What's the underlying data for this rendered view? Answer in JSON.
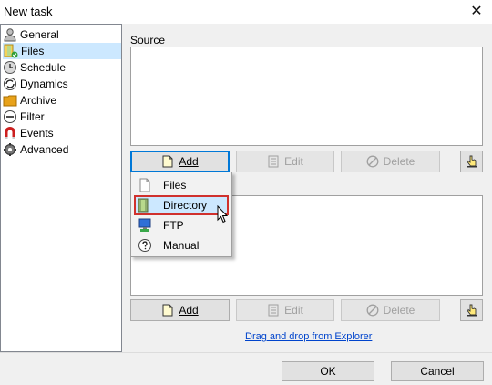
{
  "window": {
    "title": "New task",
    "close_glyph": "✕"
  },
  "nav": {
    "items": [
      {
        "label": "General",
        "icon": "person-icon"
      },
      {
        "label": "Files",
        "icon": "files-check-icon",
        "selected": true
      },
      {
        "label": "Schedule",
        "icon": "clock-icon"
      },
      {
        "label": "Dynamics",
        "icon": "sync-icon"
      },
      {
        "label": "Archive",
        "icon": "archive-folder-icon"
      },
      {
        "label": "Filter",
        "icon": "filter-minus-icon"
      },
      {
        "label": "Events",
        "icon": "magnet-icon"
      },
      {
        "label": "Advanced",
        "icon": "gear-icon"
      }
    ]
  },
  "source": {
    "label": "Source"
  },
  "toolbar_top": {
    "add": "Add",
    "edit": "Edit",
    "delete": "Delete"
  },
  "toolbar_bottom": {
    "add": "Add",
    "edit": "Edit",
    "delete": "Delete"
  },
  "menu": {
    "items": [
      {
        "label": "Files",
        "icon": "file-icon"
      },
      {
        "label": "Directory",
        "icon": "directory-icon",
        "highlighted": true
      },
      {
        "label": "FTP",
        "icon": "ftp-computer-icon"
      },
      {
        "label": "Manual",
        "icon": "help-icon"
      }
    ]
  },
  "drag_link": "Drag and drop from Explorer",
  "footer": {
    "ok": "OK",
    "cancel": "Cancel"
  },
  "colors": {
    "selection": "#cce8ff",
    "highlight_border": "#d0312d",
    "focus": "#0078d7",
    "link": "#0044cc"
  }
}
